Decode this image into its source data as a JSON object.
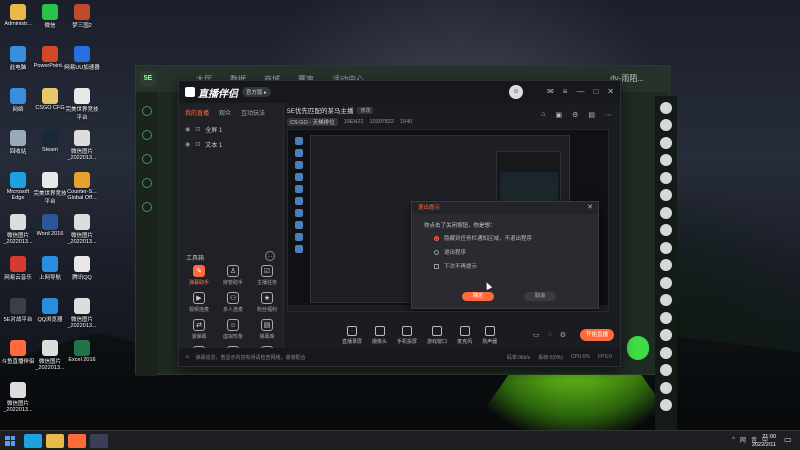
{
  "desktop": {
    "icons": [
      {
        "label": "Administr...",
        "icon": "folder-icon",
        "color": "#e8b84a"
      },
      {
        "label": "微信",
        "icon": "wechat-icon",
        "color": "#2ac24a"
      },
      {
        "label": "梦三国2",
        "icon": "game-icon",
        "color": "#c04a2a"
      },
      {
        "label": "此电脑",
        "icon": "computer-icon",
        "color": "#3a8ee0"
      },
      {
        "label": "PowerPoint...",
        "icon": "powerpoint-icon",
        "color": "#d24726"
      },
      {
        "label": "网易UU加速器",
        "icon": "uu-icon",
        "color": "#2a6fe0"
      },
      {
        "label": "网络",
        "icon": "network-icon",
        "color": "#3a8ee0"
      },
      {
        "label": "CSGO CFG",
        "icon": "folder-icon",
        "color": "#e8c86a"
      },
      {
        "label": "完美世界竞技平台",
        "icon": "perfect-world-icon",
        "color": "#e8e8e8"
      },
      {
        "label": "回收站",
        "icon": "recycle-bin-icon",
        "color": "#9ab"
      },
      {
        "label": "Steam",
        "icon": "steam-icon",
        "color": "#1b2838"
      },
      {
        "label": "微信图片_2022013...",
        "icon": "image-icon",
        "color": "#ddd"
      },
      {
        "label": "Microsoft Edge",
        "icon": "edge-icon",
        "color": "#1fa0e0"
      },
      {
        "label": "完美世界竞技平台",
        "icon": "perfect-world-icon",
        "color": "#e8e8e8"
      },
      {
        "label": "Counter-S... Global Off...",
        "icon": "csgo-icon",
        "color": "#e8a030"
      },
      {
        "label": "微信图片_2022013...",
        "icon": "image-icon",
        "color": "#ddd"
      },
      {
        "label": "Word 2016",
        "icon": "word-icon",
        "color": "#2b579a"
      },
      {
        "label": "微信图片_2022013...",
        "icon": "image-icon",
        "color": "#ddd"
      },
      {
        "label": "网易云音乐",
        "icon": "netease-music-icon",
        "color": "#d43c33"
      },
      {
        "label": "上网导航",
        "icon": "browser-icon",
        "color": "#2a8ee0"
      },
      {
        "label": "腾讯QQ",
        "icon": "qq-icon",
        "color": "#e8e8e8"
      },
      {
        "label": "5E对战平台",
        "icon": "5e-icon",
        "color": "#3a3f45"
      },
      {
        "label": "QQ浏览器",
        "icon": "qq-browser-icon",
        "color": "#2a8ee0"
      },
      {
        "label": "微信图片_2022013...",
        "icon": "image-icon",
        "color": "#ddd"
      },
      {
        "label": "斗鱼直播伴侣",
        "icon": "douyu-icon",
        "color": "#ff6a3d"
      },
      {
        "label": "微信图片_2022013...",
        "icon": "image-icon",
        "color": "#ddd"
      },
      {
        "label": "Excel 2016",
        "icon": "excel-icon",
        "color": "#217346"
      },
      {
        "label": "微信图片_2022013...",
        "icon": "image-icon",
        "color": "#ddd"
      }
    ]
  },
  "bg_app": {
    "logo": "5E",
    "nav": [
      "大厅",
      "数据",
      "商城",
      "赛事",
      "活动中心"
    ],
    "user": "dy-雨陌..."
  },
  "app": {
    "name": "直播伴侣",
    "badge": "官方版 ▸",
    "left_tabs": [
      "我的直播",
      "观众",
      "互动玩法"
    ],
    "scenes": [
      "全屏 1",
      "文本 1"
    ],
    "tools_title": "工具箱",
    "tools": [
      {
        "label": "弹幕助手",
        "hot": true
      },
      {
        "label": "房管助手",
        "hot": false
      },
      {
        "label": "主播任务",
        "hot": false
      },
      {
        "label": "视频连麦",
        "hot": false
      },
      {
        "label": "多人连麦",
        "hot": false
      },
      {
        "label": "粉丝福利",
        "hot": false
      },
      {
        "label": "滚弹幕",
        "hot": false
      },
      {
        "label": "虚拟形象",
        "hot": false
      },
      {
        "label": "弹幕库",
        "hot": false
      },
      {
        "label": "更多",
        "hot": false
      },
      {
        "label": "录屏",
        "hot": false
      },
      {
        "label": "投屏",
        "hot": false
      }
    ],
    "stream_title": "5E优先匹配的某马主播",
    "edit_label": "修改",
    "category": "CS:GO - 天梯排位",
    "room_id": "19EH22",
    "fans": "10397822",
    "hot": "1540",
    "dialog": {
      "title": "退出提示",
      "question": "你点击了关闭按钮，你是想：",
      "option1": "隐藏到任务栏通知区域，不退出程序",
      "option2": "退出程序",
      "remember": "下次不再提示",
      "ok": "确定",
      "cancel": "取消"
    },
    "bottom_tools": [
      "直播录屏",
      "摄像头",
      "手机投屏",
      "游戏窗口",
      "麦克风",
      "扬声器"
    ],
    "start_button": "开始直播",
    "status_warn": "弹幕信息，若显示内容有误请检查网络，谢谢配合",
    "stats": [
      "码率:0kb/s",
      "丢帧:0(0%)",
      "CPU:5%",
      "FPS:0"
    ]
  },
  "taskbar": {
    "apps": [
      "edge",
      "explorer",
      "douyu",
      "5e"
    ],
    "tray": [
      "^",
      "网",
      "音",
      "中"
    ],
    "time": "21:00",
    "date": "2022/2/11"
  }
}
